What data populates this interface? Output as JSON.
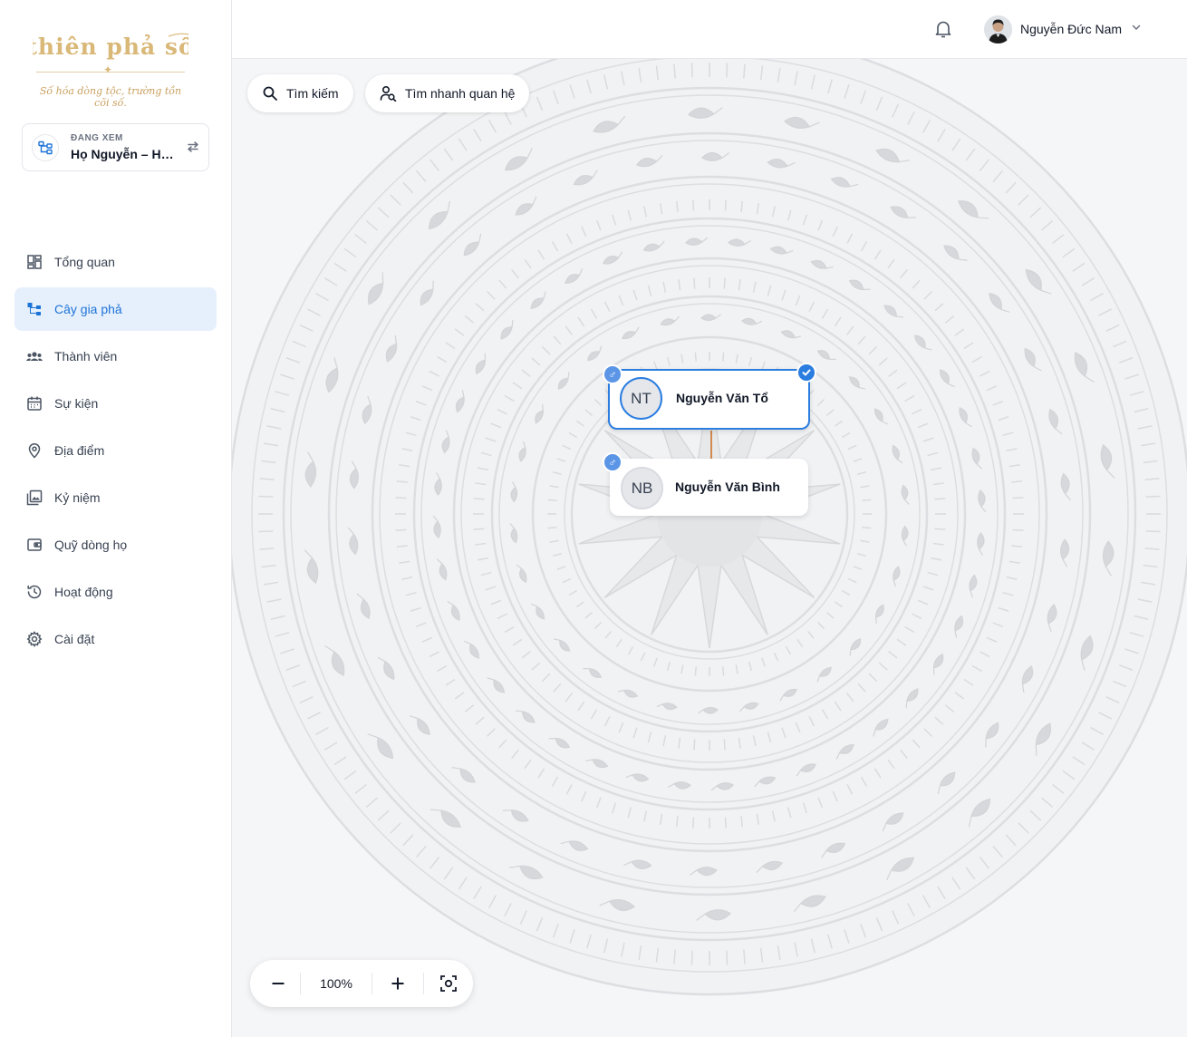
{
  "brand": {
    "title": "thiên phả số",
    "tagline": "Số hóa dòng tộc, trường tồn cõi số.",
    "gold_color": "#d9b878"
  },
  "viewing": {
    "label": "ĐANG XEM",
    "value": "Họ Nguyễn – Hà Nội"
  },
  "nav": {
    "items": [
      {
        "label": "Tổng quan",
        "icon": "dashboard-icon"
      },
      {
        "label": "Cây gia phả",
        "icon": "family-tree-icon",
        "active": true
      },
      {
        "label": "Thành viên",
        "icon": "members-icon"
      },
      {
        "label": "Sự kiện",
        "icon": "calendar-icon"
      },
      {
        "label": "Địa điểm",
        "icon": "location-pin-icon"
      },
      {
        "label": "Kỷ niệm",
        "icon": "photo-album-icon"
      },
      {
        "label": "Quỹ dòng họ",
        "icon": "wallet-icon"
      },
      {
        "label": "Hoạt động",
        "icon": "history-icon"
      },
      {
        "label": "Cài đặt",
        "icon": "gear-icon"
      }
    ],
    "active_color": "#1e73d8",
    "active_bg": "#e6f0fc"
  },
  "header": {
    "user_name": "Nguyễn Đức Nam"
  },
  "toolbar": {
    "search_label": "Tìm kiếm",
    "quick_relation_label": "Tìm nhanh quan hệ"
  },
  "tree": {
    "nodes": [
      {
        "initials": "NT",
        "name": "Nguyễn Văn Tổ",
        "gender": "♂",
        "selected": true
      },
      {
        "initials": "NB",
        "name": "Nguyễn Văn Bình",
        "gender": "♂",
        "selected": false
      }
    ],
    "link_color": "#d18a4f",
    "selected_color": "#2b7de0"
  },
  "zoom": {
    "level": "100%"
  }
}
